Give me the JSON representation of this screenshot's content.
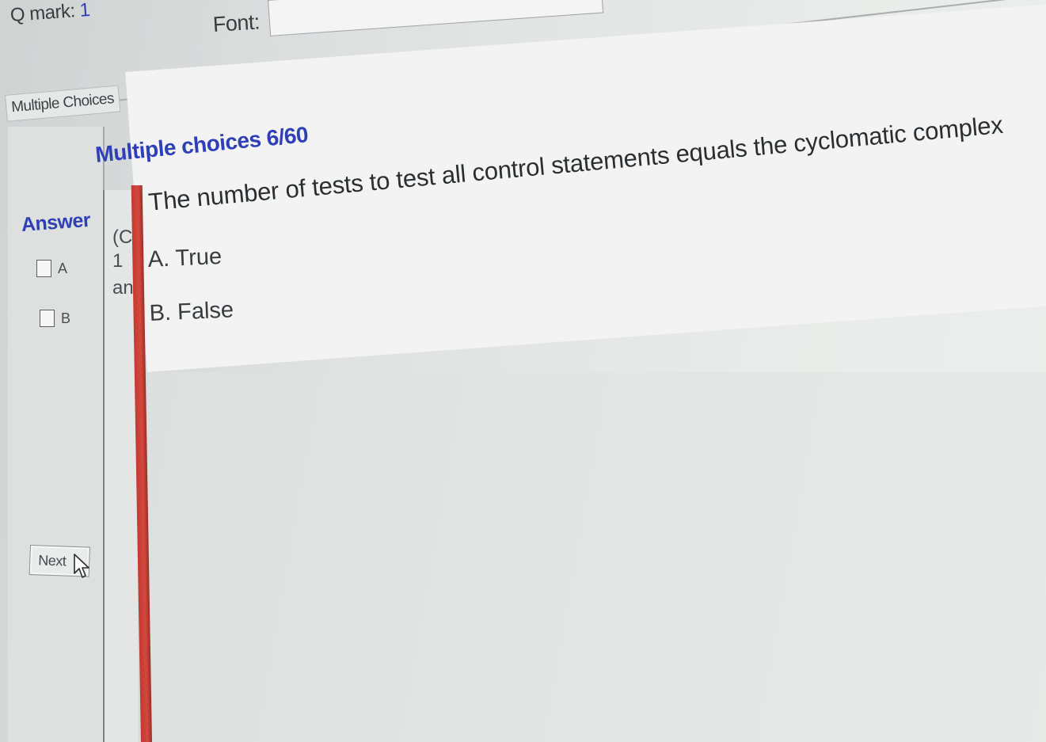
{
  "header": {
    "q_mark_label": "Q mark:",
    "q_mark_value": "1",
    "font_label": "Font:",
    "font_value": ""
  },
  "sidebar": {
    "tab_label": "Multiple Choices",
    "answer_title": "Answer",
    "options": [
      {
        "label": "A",
        "checked": false
      },
      {
        "label": "B",
        "checked": false
      }
    ],
    "next_label": "Next"
  },
  "main": {
    "section_title": "Multiple choices 6/60",
    "narrow_column_lines": [
      "(Cl",
      "1",
      "an"
    ],
    "question": "The number of tests to test all control statements equals the cyclomatic complex",
    "choices": [
      "A. True",
      "B. False"
    ]
  },
  "colors": {
    "accent_blue": "#2f3fb8",
    "red_bar": "#d4483d"
  },
  "icons": {
    "cursor": "mouse-pointer-icon"
  }
}
